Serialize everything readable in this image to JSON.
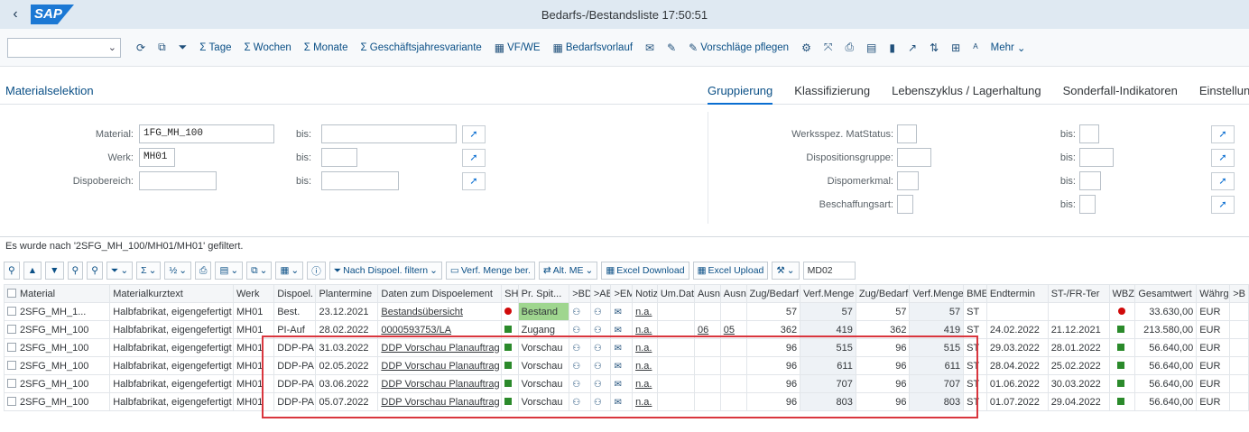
{
  "shell": {
    "back_glyph": "‹",
    "logo_text": "SAP",
    "title": "Bedarfs-/Bestandsliste 17:50:51"
  },
  "toolbar": {
    "buttons": [
      {
        "icon": "refresh-icon",
        "label": ""
      },
      {
        "icon": "copy-icon",
        "label": ""
      },
      {
        "icon": "filter-icon",
        "label": ""
      },
      {
        "icon": "sigma-icon",
        "label": "Σ Tage"
      },
      {
        "icon": "sigma-icon",
        "label": "Σ Wochen"
      },
      {
        "icon": "sigma-icon",
        "label": "Σ Monate"
      },
      {
        "icon": "sigma-icon",
        "label": "Σ Geschäftsjahresvariante"
      },
      {
        "icon": "table-icon",
        "label": "VF/WE"
      },
      {
        "icon": "table-icon",
        "label": "Bedarfsvorlauf"
      },
      {
        "icon": "mail-icon",
        "label": ""
      },
      {
        "icon": "edit-icon",
        "label": ""
      },
      {
        "icon": "edit-icon",
        "label": "Vorschläge pflegen"
      }
    ],
    "more_label": "Mehr"
  },
  "selection": {
    "title": "Materialselektion",
    "tabs": [
      "Gruppierung",
      "Klassifizierung",
      "Lebenszyklus / Lagerhaltung",
      "Sonderfall-Indikatoren",
      "Einstellung"
    ],
    "left": [
      {
        "label": "Material:",
        "value": "1FG_MH_100",
        "bis_label": "bis:"
      },
      {
        "label": "Werk:",
        "value": "MH01",
        "bis_label": "bis:"
      },
      {
        "label": "Dispobereich:",
        "value": "",
        "bis_label": "bis:"
      }
    ],
    "right": [
      {
        "label": "Werksspez. MatStatus:",
        "bis_label": "bis:"
      },
      {
        "label": "Dispositionsgruppe:",
        "bis_label": "bis:"
      },
      {
        "label": "Dispomerkmal:",
        "bis_label": "bis:"
      },
      {
        "label": "Beschaffungsart:",
        "bis_label": "bis:"
      }
    ]
  },
  "list": {
    "message": "Es wurde nach '2SFG_MH_100/MH01/MH01' gefiltert.",
    "toolbar": {
      "filter_dispoel": "Nach Dispoel. filtern",
      "verf_menge": "Verf. Menge ber.",
      "alt_me": "Alt. ME",
      "excel_download": "Excel Download",
      "excel_upload": "Excel Upload",
      "tcode": "MD02"
    },
    "columns": [
      "Material",
      "Materialkurztext",
      "Werk",
      "Dispoel.",
      "Plantermine",
      "Daten zum Dispoelement",
      "SH",
      "Pr. Spit...",
      ">BD",
      ">AB",
      ">EM",
      "Notiz",
      "Um.Dat.",
      "Ausn",
      "Ausn",
      "Zug/Bedarf",
      "Verf.Menge",
      "Zug/Bedarf",
      "Verf.Menge",
      "BME",
      "Endtermin",
      "ST-/FR-Ter",
      "WBZ",
      "Gesamtwert",
      "Währg",
      ">B"
    ],
    "rows": [
      {
        "material": "2SFG_MH_1...",
        "text": "Halbfabrikat, eigengefertigt",
        "werk": "MH01",
        "dispoel": "Best.",
        "datum": "23.12.2021",
        "daten": "Bestandsübersicht",
        "sh": "red",
        "prio": "Bestand",
        "notiz": "n.a.",
        "umdat": "",
        "ausn1": "",
        "ausn2": "",
        "zug1": "57",
        "verf1": "57",
        "zug2": "57",
        "verf2": "57",
        "bme": "ST",
        "end": "",
        "stfr": "",
        "wbz": "red",
        "wert": "33.630,00",
        "waehrg": "EUR"
      },
      {
        "material": "2SFG_MH_100",
        "text": "Halbfabrikat, eigengefertigt",
        "werk": "MH01",
        "dispoel": "PI-Auf",
        "datum": "28.02.2022",
        "daten": "0000593753/LA",
        "sh": "green",
        "prio": "Zugang",
        "notiz": "n.a.",
        "umdat": "",
        "ausn1": "06",
        "ausn2": "05",
        "zug1": "362",
        "verf1": "419",
        "zug2": "362",
        "verf2": "419",
        "bme": "ST",
        "end": "24.02.2022",
        "stfr": "21.12.2021",
        "wbz": "green",
        "wert": "213.580,00",
        "waehrg": "EUR"
      },
      {
        "material": "2SFG_MH_100",
        "text": "Halbfabrikat, eigengefertigt",
        "werk": "MH01",
        "dispoel": "DDP-PA",
        "datum": "31.03.2022",
        "daten": "DDP Vorschau Planauftrag",
        "sh": "green",
        "prio": "Vorschau",
        "notiz": "n.a.",
        "umdat": "",
        "ausn1": "",
        "ausn2": "",
        "zug1": "96",
        "verf1": "515",
        "zug2": "96",
        "verf2": "515",
        "bme": "ST",
        "end": "29.03.2022",
        "stfr": "28.01.2022",
        "wbz": "green",
        "wert": "56.640,00",
        "waehrg": "EUR"
      },
      {
        "material": "2SFG_MH_100",
        "text": "Halbfabrikat, eigengefertigt",
        "werk": "MH01",
        "dispoel": "DDP-PA",
        "datum": "02.05.2022",
        "daten": "DDP Vorschau Planauftrag",
        "sh": "green",
        "prio": "Vorschau",
        "notiz": "n.a.",
        "umdat": "",
        "ausn1": "",
        "ausn2": "",
        "zug1": "96",
        "verf1": "611",
        "zug2": "96",
        "verf2": "611",
        "bme": "ST",
        "end": "28.04.2022",
        "stfr": "25.02.2022",
        "wbz": "green",
        "wert": "56.640,00",
        "waehrg": "EUR"
      },
      {
        "material": "2SFG_MH_100",
        "text": "Halbfabrikat, eigengefertigt",
        "werk": "MH01",
        "dispoel": "DDP-PA",
        "datum": "03.06.2022",
        "daten": "DDP Vorschau Planauftrag",
        "sh": "green",
        "prio": "Vorschau",
        "notiz": "n.a.",
        "umdat": "",
        "ausn1": "",
        "ausn2": "",
        "zug1": "96",
        "verf1": "707",
        "zug2": "96",
        "verf2": "707",
        "bme": "ST",
        "end": "01.06.2022",
        "stfr": "30.03.2022",
        "wbz": "green",
        "wert": "56.640,00",
        "waehrg": "EUR"
      },
      {
        "material": "2SFG_MH_100",
        "text": "Halbfabrikat, eigengefertigt",
        "werk": "MH01",
        "dispoel": "DDP-PA",
        "datum": "05.07.2022",
        "daten": "DDP Vorschau Planauftrag",
        "sh": "green",
        "prio": "Vorschau",
        "notiz": "n.a.",
        "umdat": "",
        "ausn1": "",
        "ausn2": "",
        "zug1": "96",
        "verf1": "803",
        "zug2": "96",
        "verf2": "803",
        "bme": "ST",
        "end": "01.07.2022",
        "stfr": "29.04.2022",
        "wbz": "green",
        "wert": "56.640,00",
        "waehrg": "EUR"
      }
    ]
  },
  "colors": {
    "shell_bg": "#dfe9f2",
    "accent": "#0a6ed1",
    "highlight_box": "#d9363e",
    "bestand_green": "#9fd68f"
  }
}
